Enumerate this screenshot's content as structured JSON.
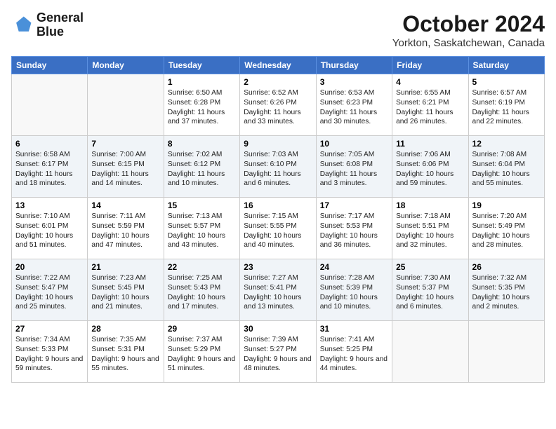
{
  "logo": {
    "line1": "General",
    "line2": "Blue"
  },
  "title": "October 2024",
  "subtitle": "Yorkton, Saskatchewan, Canada",
  "headers": [
    "Sunday",
    "Monday",
    "Tuesday",
    "Wednesday",
    "Thursday",
    "Friday",
    "Saturday"
  ],
  "weeks": [
    [
      {
        "empty": true
      },
      {
        "empty": true
      },
      {
        "day": "1",
        "sunrise": "6:50 AM",
        "sunset": "6:28 PM",
        "daylight": "11 hours and 37 minutes."
      },
      {
        "day": "2",
        "sunrise": "6:52 AM",
        "sunset": "6:26 PM",
        "daylight": "11 hours and 33 minutes."
      },
      {
        "day": "3",
        "sunrise": "6:53 AM",
        "sunset": "6:23 PM",
        "daylight": "11 hours and 30 minutes."
      },
      {
        "day": "4",
        "sunrise": "6:55 AM",
        "sunset": "6:21 PM",
        "daylight": "11 hours and 26 minutes."
      },
      {
        "day": "5",
        "sunrise": "6:57 AM",
        "sunset": "6:19 PM",
        "daylight": "11 hours and 22 minutes."
      }
    ],
    [
      {
        "day": "6",
        "sunrise": "6:58 AM",
        "sunset": "6:17 PM",
        "daylight": "11 hours and 18 minutes."
      },
      {
        "day": "7",
        "sunrise": "7:00 AM",
        "sunset": "6:15 PM",
        "daylight": "11 hours and 14 minutes."
      },
      {
        "day": "8",
        "sunrise": "7:02 AM",
        "sunset": "6:12 PM",
        "daylight": "11 hours and 10 minutes."
      },
      {
        "day": "9",
        "sunrise": "7:03 AM",
        "sunset": "6:10 PM",
        "daylight": "11 hours and 6 minutes."
      },
      {
        "day": "10",
        "sunrise": "7:05 AM",
        "sunset": "6:08 PM",
        "daylight": "11 hours and 3 minutes."
      },
      {
        "day": "11",
        "sunrise": "7:06 AM",
        "sunset": "6:06 PM",
        "daylight": "10 hours and 59 minutes."
      },
      {
        "day": "12",
        "sunrise": "7:08 AM",
        "sunset": "6:04 PM",
        "daylight": "10 hours and 55 minutes."
      }
    ],
    [
      {
        "day": "13",
        "sunrise": "7:10 AM",
        "sunset": "6:01 PM",
        "daylight": "10 hours and 51 minutes."
      },
      {
        "day": "14",
        "sunrise": "7:11 AM",
        "sunset": "5:59 PM",
        "daylight": "10 hours and 47 minutes."
      },
      {
        "day": "15",
        "sunrise": "7:13 AM",
        "sunset": "5:57 PM",
        "daylight": "10 hours and 43 minutes."
      },
      {
        "day": "16",
        "sunrise": "7:15 AM",
        "sunset": "5:55 PM",
        "daylight": "10 hours and 40 minutes."
      },
      {
        "day": "17",
        "sunrise": "7:17 AM",
        "sunset": "5:53 PM",
        "daylight": "10 hours and 36 minutes."
      },
      {
        "day": "18",
        "sunrise": "7:18 AM",
        "sunset": "5:51 PM",
        "daylight": "10 hours and 32 minutes."
      },
      {
        "day": "19",
        "sunrise": "7:20 AM",
        "sunset": "5:49 PM",
        "daylight": "10 hours and 28 minutes."
      }
    ],
    [
      {
        "day": "20",
        "sunrise": "7:22 AM",
        "sunset": "5:47 PM",
        "daylight": "10 hours and 25 minutes."
      },
      {
        "day": "21",
        "sunrise": "7:23 AM",
        "sunset": "5:45 PM",
        "daylight": "10 hours and 21 minutes."
      },
      {
        "day": "22",
        "sunrise": "7:25 AM",
        "sunset": "5:43 PM",
        "daylight": "10 hours and 17 minutes."
      },
      {
        "day": "23",
        "sunrise": "7:27 AM",
        "sunset": "5:41 PM",
        "daylight": "10 hours and 13 minutes."
      },
      {
        "day": "24",
        "sunrise": "7:28 AM",
        "sunset": "5:39 PM",
        "daylight": "10 hours and 10 minutes."
      },
      {
        "day": "25",
        "sunrise": "7:30 AM",
        "sunset": "5:37 PM",
        "daylight": "10 hours and 6 minutes."
      },
      {
        "day": "26",
        "sunrise": "7:32 AM",
        "sunset": "5:35 PM",
        "daylight": "10 hours and 2 minutes."
      }
    ],
    [
      {
        "day": "27",
        "sunrise": "7:34 AM",
        "sunset": "5:33 PM",
        "daylight": "9 hours and 59 minutes."
      },
      {
        "day": "28",
        "sunrise": "7:35 AM",
        "sunset": "5:31 PM",
        "daylight": "9 hours and 55 minutes."
      },
      {
        "day": "29",
        "sunrise": "7:37 AM",
        "sunset": "5:29 PM",
        "daylight": "9 hours and 51 minutes."
      },
      {
        "day": "30",
        "sunrise": "7:39 AM",
        "sunset": "5:27 PM",
        "daylight": "9 hours and 48 minutes."
      },
      {
        "day": "31",
        "sunrise": "7:41 AM",
        "sunset": "5:25 PM",
        "daylight": "9 hours and 44 minutes."
      },
      {
        "empty": true
      },
      {
        "empty": true
      }
    ]
  ]
}
